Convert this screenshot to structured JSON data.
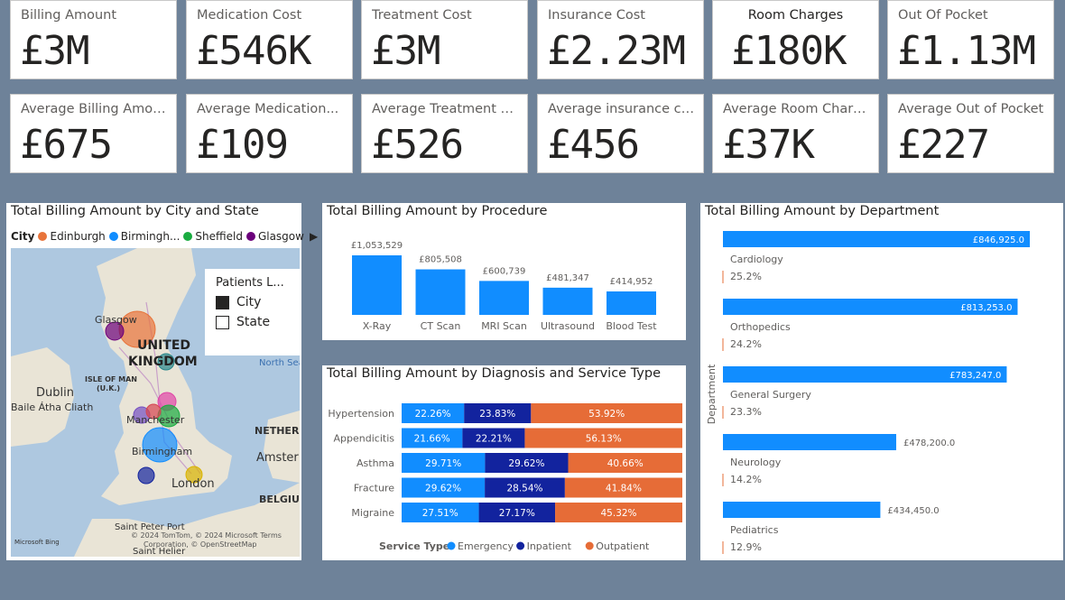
{
  "kpis_row1": [
    {
      "label": "Billing Amount",
      "value": "£3M"
    },
    {
      "label": "Medication Cost",
      "value": "£546K"
    },
    {
      "label": "Treatment Cost",
      "value": "£3M"
    },
    {
      "label": "Insurance Cost",
      "value": "£2.23M"
    },
    {
      "label": "Room Charges",
      "value": "£180K"
    },
    {
      "label": "Out Of Pocket",
      "value": "£1.13M"
    }
  ],
  "kpis_row2": [
    {
      "label": "Average Billing Amou...",
      "value": "£675"
    },
    {
      "label": "Average Medication...",
      "value": "£109"
    },
    {
      "label": "Average Treatment Cost",
      "value": "£526"
    },
    {
      "label": "Average insurance cover",
      "value": "£456"
    },
    {
      "label": "Average Room Charges",
      "value": "£37K"
    },
    {
      "label": "Average Out of Pocket",
      "value": "£227"
    }
  ],
  "map_visual": {
    "title": "Total Billing Amount by City and State",
    "legend_title": "City",
    "legend_items": [
      {
        "label": "Edinburgh",
        "color": "#e8743b"
      },
      {
        "label": "Birmingh...",
        "color": "#118dff"
      },
      {
        "label": "Sheffield",
        "color": "#1aab40"
      },
      {
        "label": "Glasgow",
        "color": "#6b007b"
      }
    ],
    "layer_panel": {
      "title": "Patients L...",
      "options": [
        {
          "label": "City",
          "checked": true
        },
        {
          "label": "State",
          "checked": false
        }
      ]
    },
    "labels": {
      "glasgow": "Glasgow",
      "uk1": "UNITED",
      "uk2": "KINGDOM",
      "north_sea": "North Sea",
      "dublin": "Dublin",
      "baile": "Baile Átha Cliath",
      "isle1": "ISLE OF MAN",
      "isle2": "(U.K.)",
      "manchester": "Manchester",
      "birmingham": "Birmingham",
      "london": "London",
      "netherlands": "NETHERL",
      "amsterdam": "Amster",
      "belgium": "BELGIU",
      "saint_peter": "Saint Peter Port",
      "saint_helier": "Saint Helier",
      "copyright": "© 2024 TomTom, © 2024 Microsoft  Terms",
      "corporation": "Corporation, © OpenStreetMap",
      "bing": "Microsoft Bing"
    }
  },
  "procedure_chart": {
    "title": "Total Billing Amount by Procedure",
    "chart_data": {
      "type": "bar",
      "categories": [
        "X-Ray",
        "CT Scan",
        "MRI Scan",
        "Ultrasound",
        "Blood Test"
      ],
      "values": [
        1053529,
        805508,
        600739,
        481347,
        414952
      ],
      "value_labels": [
        "£1,053,529",
        "£805,508",
        "£600,739",
        "£481,347",
        "£414,952"
      ],
      "color": "#118dff"
    }
  },
  "diagnosis_chart": {
    "title": "Total Billing Amount by Diagnosis and Service Type",
    "legend_title": "Service Type",
    "chart_data": {
      "type": "bar",
      "stacked_percent": true,
      "categories": [
        "Hypertension",
        "Appendicitis",
        "Asthma",
        "Fracture",
        "Migraine"
      ],
      "series": [
        {
          "name": "Emergency",
          "color": "#118dff",
          "values": [
            22.26,
            21.66,
            29.71,
            29.62,
            27.51
          ]
        },
        {
          "name": "Inpatient",
          "color": "#12239e",
          "values": [
            23.83,
            22.21,
            29.62,
            28.54,
            27.17
          ]
        },
        {
          "name": "Outpatient",
          "color": "#e66c37",
          "values": [
            53.92,
            56.13,
            40.66,
            41.84,
            45.32
          ]
        }
      ]
    }
  },
  "department_chart": {
    "title": "Total Billing Amount by Department",
    "ylabel": "Department",
    "chart_data": {
      "type": "bar",
      "orientation": "horizontal",
      "categories": [
        "Cardiology",
        "Orthopedics",
        "General Surgery",
        "Neurology",
        "Pediatrics"
      ],
      "values": [
        846925,
        813253,
        783247,
        478200,
        434450
      ],
      "value_labels": [
        "£846,925.0",
        "£813,253.0",
        "£783,247.0",
        "£478,200.0",
        "£434,450.0"
      ],
      "shares": [
        "25.2%",
        "24.2%",
        "23.3%",
        "14.2%",
        "12.9%"
      ],
      "color": "#118dff"
    }
  }
}
